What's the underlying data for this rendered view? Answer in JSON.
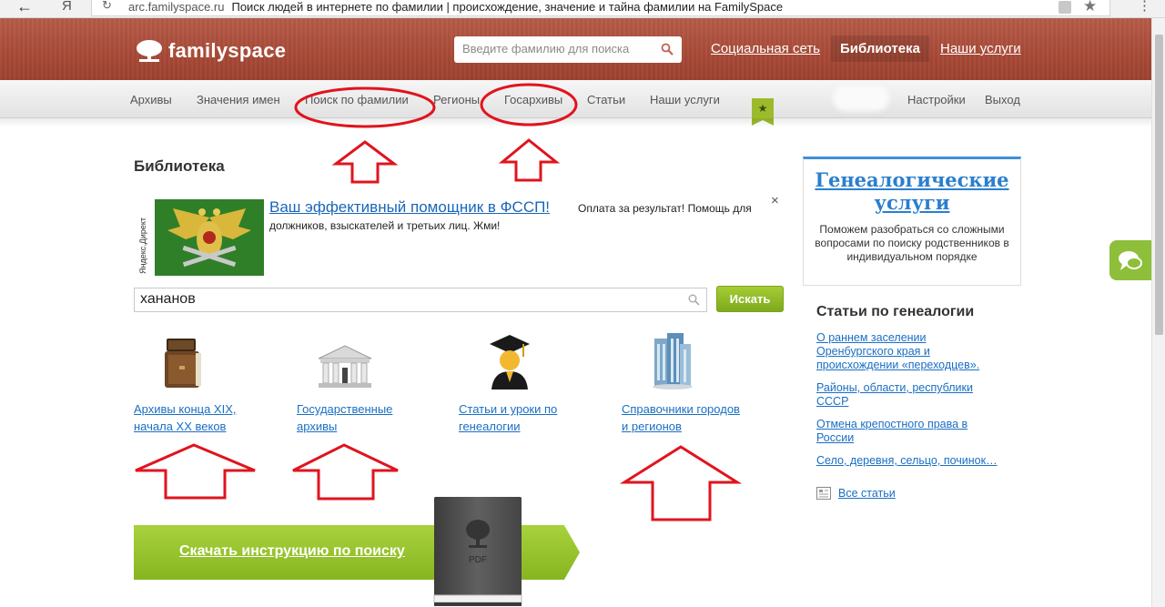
{
  "browser": {
    "back": "←",
    "forward": "Я",
    "url": "arc.familyspace.ru",
    "page_title": "Поиск людей в интернете по фамилии | происхождение, значение и тайна фамилии на FamilySpace"
  },
  "header": {
    "logo": "familyspace",
    "search_placeholder": "Введите фамилию для поиска",
    "links": [
      "Социальная сеть",
      "Библиотека",
      "Наши услуги"
    ]
  },
  "nav": {
    "items": [
      "Архивы",
      "Значения имен",
      "Поиск по фамилии",
      "Регионы",
      "Госархивы",
      "Статьи",
      "Наши услуги"
    ],
    "flag_icon": "★",
    "right": [
      "Настройки",
      "Выход"
    ]
  },
  "main": {
    "heading": "Библиотека",
    "ad": {
      "tag": "Яндекс.Директ",
      "title": "Ваш эффективный помощник в ФССП!",
      "text_line1": "Оплата за результат! Помощь для",
      "text_line2": "должников, взыскателей и третьих лиц. Жми!",
      "close": "×"
    },
    "search": {
      "value": "хананов",
      "button": "Искать"
    },
    "categories": [
      {
        "icon": "books-icon",
        "line1": "Архивы конца XIX,",
        "line2": "начала XX веков"
      },
      {
        "icon": "building-icon",
        "line1": "Государственные",
        "line2": "архивы"
      },
      {
        "icon": "graduate-icon",
        "line1": "Статьи и уроки по",
        "line2": "генеалогии"
      },
      {
        "icon": "skyscraper-icon",
        "line1": "Справочники городов",
        "line2": "и регионов"
      }
    ],
    "download": {
      "label": "Скачать инструкцию по поиску",
      "book_label": "PDF"
    }
  },
  "sidebar": {
    "box_title": "Генеалогические услуги",
    "box_title_line1": "Генеалогические",
    "box_title_line2": "услуги",
    "box_text": "Поможем разобраться со сложными вопросами по поиску родственников в индивидуальном порядке",
    "articles_heading": "Статьи по генеалогии",
    "articles": [
      {
        "line1": "О раннем заселении",
        "line2": "Оренбургского края и",
        "line3": "происхождении «переходцев»."
      },
      {
        "line1": "Районы, области, республики",
        "line2": "СССР"
      },
      {
        "line1": "Отмена крепостного права в",
        "line2": "России"
      },
      {
        "line1": "Село, деревня, сельцо, починок…"
      }
    ],
    "all_articles": "Все статьи"
  },
  "colors": {
    "header_red": "#a84a37",
    "link_blue": "#1a6fc3",
    "green": "#8dbf3a",
    "annotation_red": "#e0141e"
  }
}
